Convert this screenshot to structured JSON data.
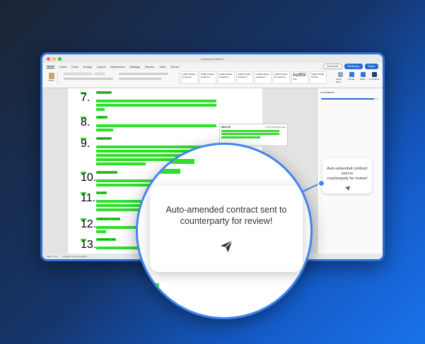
{
  "window": {
    "doc_title": "Luminance NDA v1",
    "tabs": [
      "Home",
      "Insert",
      "Draw",
      "Design",
      "Layout",
      "References",
      "Mailings",
      "Review",
      "View",
      "Tell me"
    ],
    "comments_label": "Comments",
    "reviewing_label": "Reviewing",
    "share_label": "Share"
  },
  "ribbon": {
    "paste_label": "Paste",
    "styles": [
      {
        "sample": "AaBbCcDdEe",
        "name": "Heading 1"
      },
      {
        "sample": "AaBbCcDdEe",
        "name": "Heading 2"
      },
      {
        "sample": "AaBbCcDdEe",
        "name": "Heading 3"
      },
      {
        "sample": "AaBbCcDdEe",
        "name": "Heading 4"
      },
      {
        "sample": "AaBbCcDdEe",
        "name": "Heading 5"
      },
      {
        "sample": "AaBbCcDdEe",
        "name": "No Spacing"
      },
      {
        "sample": "AaBbl",
        "name": "Title"
      },
      {
        "sample": "AaBbCcDdEe",
        "name": "Subtitle"
      }
    ],
    "actions": [
      {
        "name": "Styles Pane",
        "icon": "styles-pane-icon"
      },
      {
        "name": "Dictate",
        "icon": "microphone-icon"
      },
      {
        "name": "Editor",
        "icon": "editor-icon"
      },
      {
        "name": "Luminance",
        "icon": "luminance-icon"
      }
    ]
  },
  "document": {
    "sections": [
      {
        "num": "7.",
        "heading": "ASSIGNMENT"
      },
      {
        "num": "8.",
        "heading": "LIABILITY"
      },
      {
        "num": "9.",
        "heading": "WARRANTIES"
      },
      {
        "num": "10.",
        "heading": "NON-SOLICITATION"
      },
      {
        "num": "11.",
        "heading": "NO-SALE"
      },
      {
        "num": "12.",
        "heading": "THIRD PARTY RIGHTS"
      },
      {
        "num": "13.",
        "heading": "GOVERNING LAW"
      }
    ],
    "comment_author": "Harry B",
    "comment_time": "A few seconds ago"
  },
  "pane": {
    "title": "Luminance",
    "progress_fraction": 0.92
  },
  "status": {
    "page": "Page 7 of 8",
    "words": "English (United Kingdom)"
  },
  "notification": {
    "message_line1": "Auto-amended contract sent to",
    "message_line2": "counterparty for review!",
    "icon": "paper-plane-icon"
  },
  "colors": {
    "accent": "#3f86ee",
    "highlight": "#2ee02c",
    "word_blue": "#2b579a"
  }
}
